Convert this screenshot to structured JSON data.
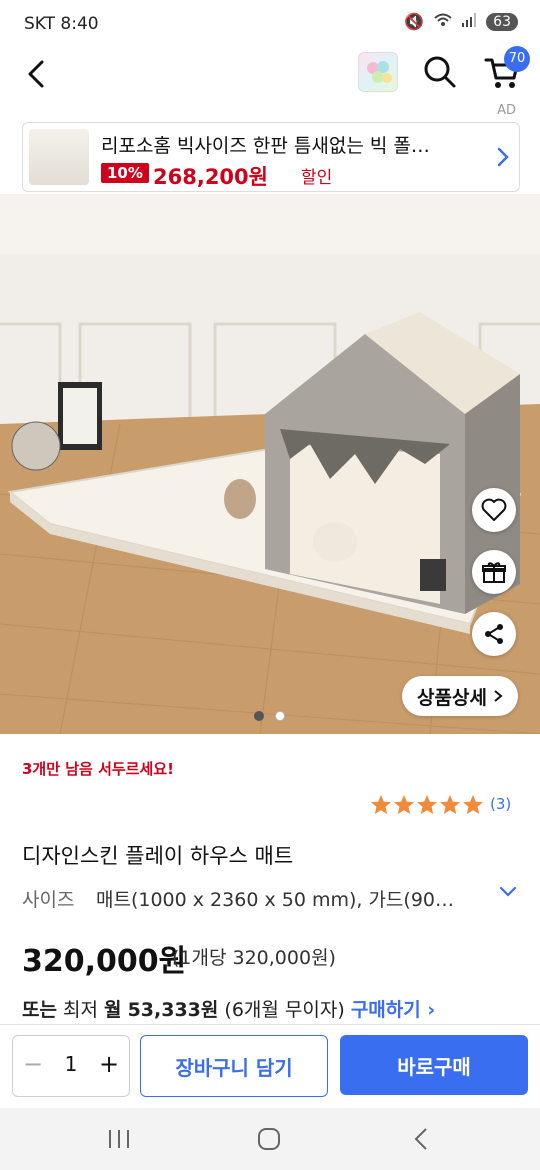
{
  "status_bar": {
    "carrier_time": "SKT 8:40",
    "battery": "63"
  },
  "header": {
    "cart_count": "70"
  },
  "ad": {
    "label": "AD",
    "title": "리포소홈 빅사이즈 한판 틈새없는 빅 폴…",
    "discount": "10%",
    "price": "268,200원",
    "price_suffix": "할인"
  },
  "gallery": {
    "detail_button": "상품상세",
    "page_dots": 2,
    "active_dot": 0
  },
  "product": {
    "stock_note": "3개만 남음 서두르세요!",
    "rating_stars": 5,
    "review_count": "(3)",
    "title": "디자인스킨 플레이 하우스 매트",
    "option_label": "사이즈",
    "option_value": "매트(1000 x 2360 x 50 mm), 가드(90…",
    "price": "320,000원",
    "unit_price": "(1개당 320,000원)",
    "installment": {
      "prefix": "또는",
      "min_label": "최저",
      "monthly_label": "월",
      "monthly_amount": "53,333원",
      "plan": "(6개월 무이자)",
      "link": "구매하기"
    }
  },
  "actions": {
    "quantity": "1",
    "add_to_cart": "장바구니 담기",
    "buy_now": "바로구매"
  },
  "colors": {
    "accent": "#3a6ef0",
    "sale_red": "#d0021b",
    "star": "#f08b3a"
  }
}
